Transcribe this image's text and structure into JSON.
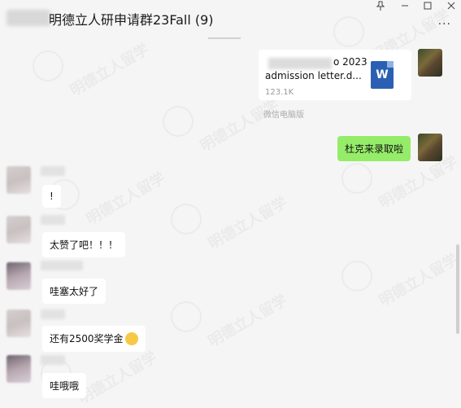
{
  "window": {
    "title": "明德立人研申请群23Fall (9)",
    "pin_icon": "pin-icon",
    "minimize_icon": "minimize-icon",
    "maximize_icon": "maximize-icon",
    "close_icon": "close-icon",
    "more_icon": "more-icon"
  },
  "file_message": {
    "name_line1": "o 2023",
    "name_line2": "admission letter.d...",
    "size": "123.1K",
    "source": "微信电脑版",
    "icon": "word-document-icon",
    "icon_letter": "W"
  },
  "messages": [
    {
      "text": "杜克来录取啦",
      "mine": true
    },
    {
      "text": "!",
      "mine": false
    },
    {
      "text": "太赞了吧！！！",
      "mine": false
    },
    {
      "text": "哇塞太好了",
      "mine": false
    },
    {
      "text": "还有2500奖学金",
      "mine": false,
      "emoji": "thinking-emoji"
    },
    {
      "text": "哇哦哦",
      "mine": false
    }
  ],
  "watermark_text": "明德立人留学"
}
